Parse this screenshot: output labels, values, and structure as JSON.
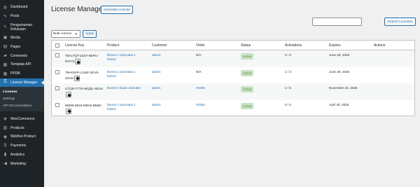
{
  "sidebar": {
    "items": [
      {
        "label": "Dashboard",
        "icon": "dashboard-icon",
        "glyph": "◍"
      },
      {
        "label": "Posts",
        "icon": "pin-icon",
        "glyph": "✎"
      },
      {
        "label": "Pengumuman Kelulusan",
        "icon": "pin-icon",
        "glyph": "✎"
      },
      {
        "label": "Media",
        "icon": "media-icon",
        "glyph": "▣"
      },
      {
        "label": "Pages",
        "icon": "page-icon",
        "glyph": "▤"
      },
      {
        "label": "Comments",
        "icon": "comment-icon",
        "glyph": "▰"
      },
      {
        "label": "Template API",
        "icon": "template-icon",
        "glyph": "▦"
      },
      {
        "label": "PPDB",
        "icon": "form-icon",
        "glyph": "▦"
      },
      {
        "label": "License Manager",
        "icon": "key-icon",
        "glyph": "⚿"
      }
    ],
    "submenu": [
      "Licenses",
      "Settings",
      "API Documentation"
    ],
    "items_after": [
      {
        "label": "WooCommerce",
        "icon": "woocommerce-icon",
        "glyph": "◈"
      },
      {
        "label": "Products",
        "icon": "archive-icon",
        "glyph": "▥"
      },
      {
        "label": "WaWoo Product",
        "icon": "chat-icon",
        "glyph": "◉"
      },
      {
        "label": "Payments",
        "icon": "payments-icon",
        "glyph": "$"
      },
      {
        "label": "Analytics",
        "icon": "analytics-icon",
        "glyph": "▮"
      },
      {
        "label": "Marketing",
        "icon": "megaphone-icon",
        "glyph": "◀"
      }
    ]
  },
  "header": {
    "title": "License Manager",
    "generate_label": "Generate License"
  },
  "search": {
    "value": "",
    "button_label": "Search Licenses"
  },
  "bulk": {
    "selected": "Bulk Actions",
    "apply_label": "Apply"
  },
  "table": {
    "columns": [
      "License Key",
      "Product",
      "Customer",
      "Order",
      "Status",
      "Activations",
      "Expires",
      "Actions"
    ],
    "rows": [
      {
        "key": "TM-LFQT-1ES7-B5PU-ROYS",
        "product": "lisensi 1 (otomatis 1 bulan)",
        "customer": "admin",
        "order": "N/A",
        "status": "Active",
        "activations": "2 / 3",
        "expires": "June 29, 2025"
      },
      {
        "key": "TM-K6VP-L1WZ-VEV9-JDUS",
        "product": "lisensi 1 (otomatis 1 bulan)",
        "customer": "admin",
        "order": "N/A",
        "status": "Active",
        "activations": "1 / 3",
        "expires": "June 28, 2025"
      },
      {
        "key": "G7QD-T7T5-WQQL-5EU6",
        "product": "lisensi 3 bulan otomatis",
        "customer": "admin",
        "order": "#4286",
        "status": "Active",
        "activations": "1 / 5",
        "expires": "November 23, 2025"
      },
      {
        "key": "B8W6-8518-M0G6-BM8A",
        "product": "lisensi 1 (otomatis 1 bulan)",
        "customer": "admin",
        "order": "#4284",
        "status": "Active",
        "activations": "0 / 4",
        "expires": "April 30, 2025"
      }
    ]
  },
  "colors": {
    "sidebar_bg": "#1d2327",
    "accent": "#2271b1",
    "active_badge_bg": "#c6e1c6",
    "active_badge_text": "#5b841b"
  }
}
